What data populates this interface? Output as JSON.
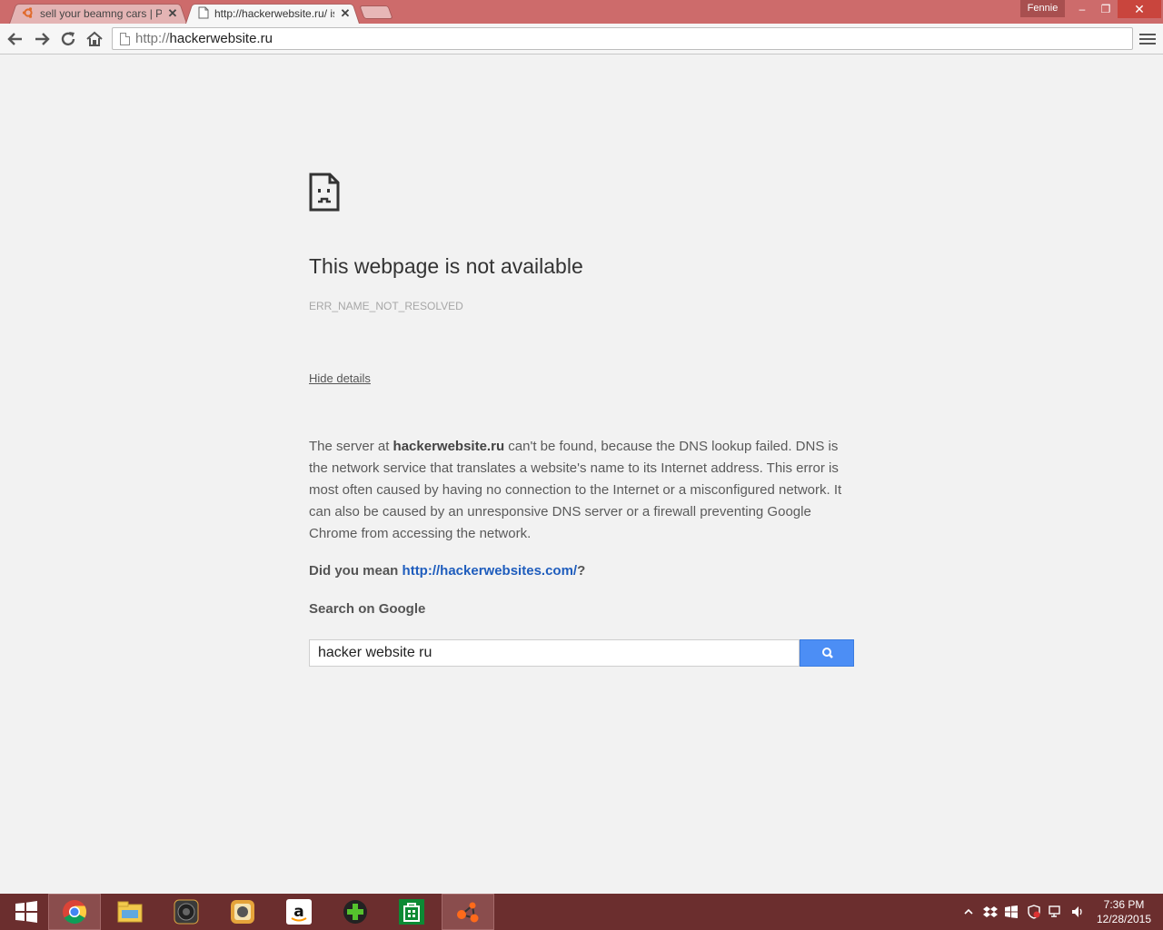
{
  "browser": {
    "tabs": [
      {
        "title": "sell your beamng cars | Pa",
        "favicon": "ubuntu-forum-icon"
      },
      {
        "title": "http://hackerwebsite.ru/ is",
        "favicon": "page-icon"
      }
    ],
    "tab_close_glyph": "✕",
    "profile_name": "Fennie",
    "window_controls": {
      "minimize": "‒",
      "maximize": "❐",
      "close": "✕"
    },
    "url_scheme": "http://",
    "url_host": "hackerwebsite.ru"
  },
  "error_page": {
    "headline": "This webpage is not available",
    "error_code": "ERR_NAME_NOT_RESOLVED",
    "hide_details_label": "Hide details",
    "explanation_prefix": "The server at ",
    "explanation_host": "hackerwebsite.ru",
    "explanation_suffix": " can't be found, because the DNS lookup failed. DNS is the network service that translates a website's name to its Internet address. This error is most often caused by having no connection to the Internet or a misconfigured network. It can also be caused by an unresponsive DNS server or a firewall preventing Google Chrome from accessing the network.",
    "did_you_mean_label": "Did you mean ",
    "did_you_mean_link": "http://hackerwebsites.com/",
    "did_you_mean_end": "?",
    "search_label": "Search on Google",
    "search_value": "hacker website ru"
  },
  "taskbar": {
    "apps": [
      "windows-start",
      "chrome",
      "file-explorer",
      "speaker-app",
      "media-app",
      "amazon",
      "game-app",
      "store",
      "network-app"
    ],
    "clock_time": "7:36 PM",
    "clock_date": "12/28/2015"
  },
  "colors": {
    "frame": "#cd6b6b",
    "taskbar": "#6b2e2e",
    "search_button": "#4c8ef5",
    "link": "#1f5dbd"
  }
}
